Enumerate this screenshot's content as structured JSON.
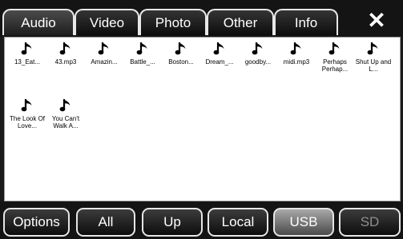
{
  "tabs": [
    {
      "label": "Audio",
      "active": true
    },
    {
      "label": "Video",
      "active": false
    },
    {
      "label": "Photo",
      "active": false
    },
    {
      "label": "Other",
      "active": false
    },
    {
      "label": "Info",
      "active": false
    }
  ],
  "close_label": "✕",
  "files": [
    {
      "name": "13_Eat...",
      "icon": "music-note-icon"
    },
    {
      "name": "43.mp3",
      "icon": "music-note-icon"
    },
    {
      "name": "Amazin...",
      "icon": "music-note-icon"
    },
    {
      "name": "Battle_...",
      "icon": "music-note-icon"
    },
    {
      "name": "Boston...",
      "icon": "music-note-icon"
    },
    {
      "name": "Dream_...",
      "icon": "music-note-icon"
    },
    {
      "name": "goodby...",
      "icon": "music-note-icon"
    },
    {
      "name": "midi.mp3",
      "icon": "music-note-icon"
    },
    {
      "name": "Perhaps Perhap...",
      "icon": "music-note-icon"
    },
    {
      "name": "Shut Up and L...",
      "icon": "music-note-icon"
    },
    {
      "name": "The Look Of Love...",
      "icon": "music-note-icon"
    },
    {
      "name": "You Can't Walk A...",
      "icon": "music-note-icon"
    }
  ],
  "bottom_buttons": [
    {
      "label": "Options",
      "state": "normal"
    },
    {
      "label": "All",
      "state": "normal"
    },
    {
      "label": "Up",
      "state": "normal"
    },
    {
      "label": "Local",
      "state": "normal"
    },
    {
      "label": "USB",
      "state": "selected"
    },
    {
      "label": "SD",
      "state": "disabled"
    }
  ],
  "colors": {
    "background": "#1a1a1a",
    "pane": "#ffffff",
    "button_border": "#e6e6e6",
    "selected_button": "#8a8a8a",
    "disabled_text": "#8e8e8e"
  }
}
